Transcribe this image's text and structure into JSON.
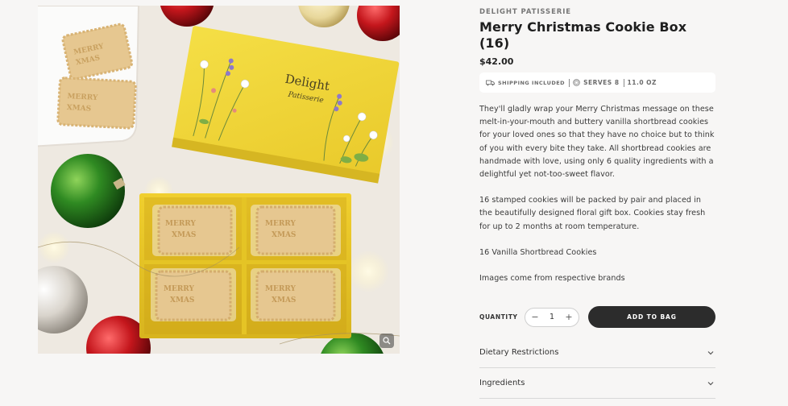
{
  "product": {
    "brand": "DELIGHT PATISSERIE",
    "title": "Merry Christmas Cookie Box (16)",
    "price": "$42.00",
    "shipping": "SHIPPING INCLUDED",
    "serves": "SERVES 8",
    "size": "11.0 OZ",
    "description": [
      "They'll gladly wrap your Merry Christmas message on these melt-in-your-mouth and buttery vanilla shortbread cookies for your loved ones so that they have no choice but to think of you with every bite they take. All shortbread cookies are handmade with love, using only 6 quality ingredients with a delightful yet not-too-sweet flavor.",
      "16 stamped cookies will be packed by pair and placed in the beautifully designed floral gift box. Cookies stay fresh for up to 2 months at room temperature.",
      "16 Vanilla Shortbread Cookies",
      "Images come from respective brands"
    ]
  },
  "purchase": {
    "quantity_label": "QUANTITY",
    "quantity": "1",
    "minus": "−",
    "plus": "+",
    "add_label": "ADD TO BAG"
  },
  "accordion": [
    {
      "label": "Dietary Restrictions"
    },
    {
      "label": "Ingredients"
    }
  ],
  "image": {
    "box_brand_line1": "Delight",
    "box_brand_line2": "Patisserie",
    "cookie_line1": "MERRY",
    "cookie_line2": "XMAS"
  },
  "icons": {
    "shipping": "truck-icon",
    "serves": "plate-icon",
    "zoom": "magnifier-icon",
    "accordion": "chevron-down-icon"
  },
  "colors": {
    "background": "#f7f6f5",
    "button": "#2c2c2c",
    "box_yellow": "#f2d93a"
  }
}
